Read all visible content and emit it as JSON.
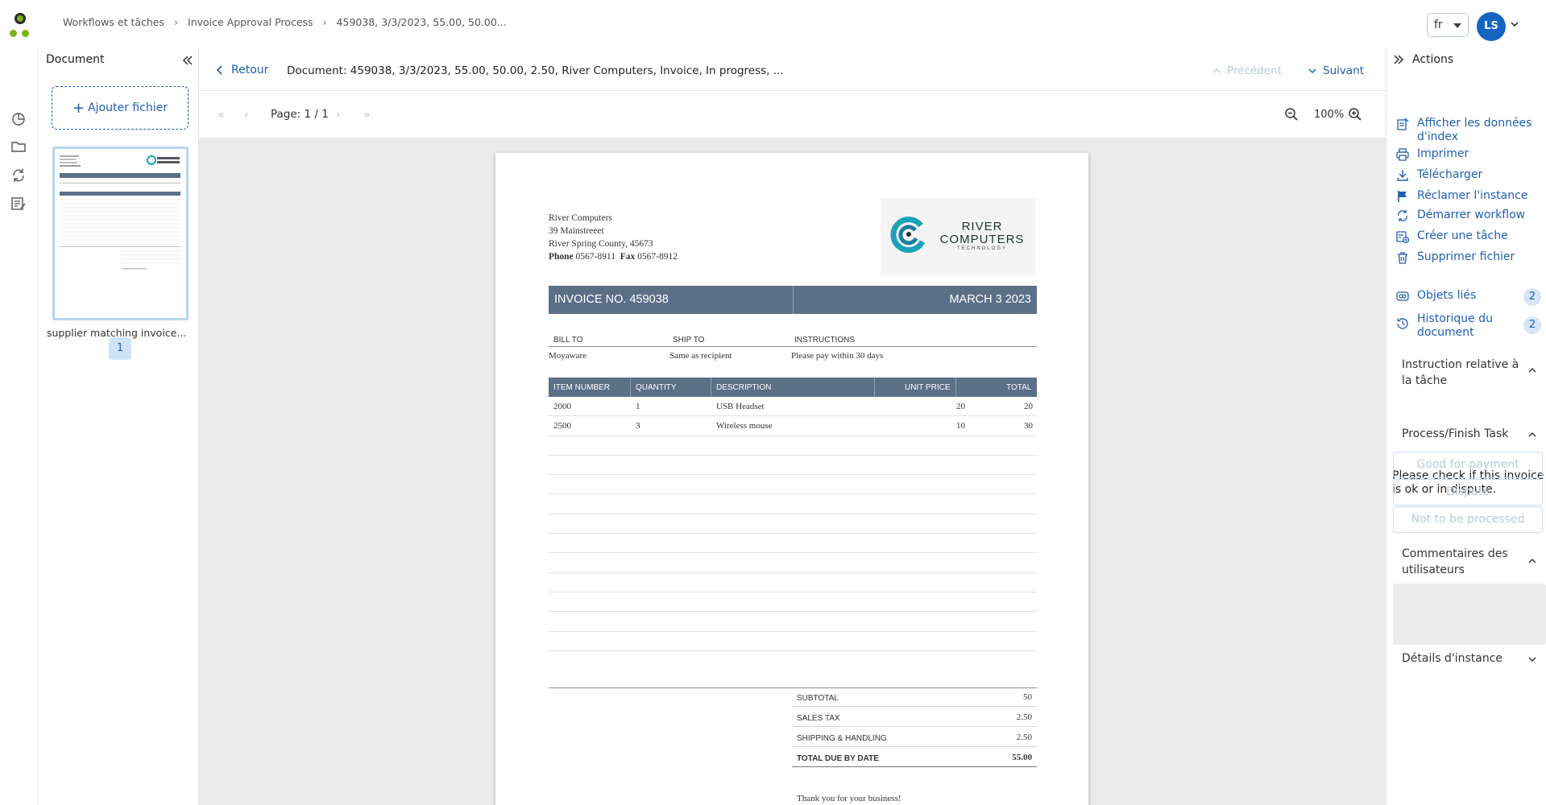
{
  "colors": {
    "accent": "#1f5fb0",
    "avatar": "#1565c0",
    "invoice_band": "#5b6f87",
    "logo_teal": "#1aa3b8"
  },
  "breadcrumb": {
    "items": [
      "Workflows et tâches",
      "Invoice Approval Process",
      "459038, 3/3/2023, 55.00, 50.00..."
    ]
  },
  "header": {
    "language": "fr",
    "user_initials": "LS"
  },
  "rail": {
    "icons": [
      "dashboard-icon",
      "folder-icon",
      "sync-icon",
      "task-list-icon"
    ]
  },
  "document_panel": {
    "title": "Document",
    "add_file_label": "Ajouter fichier",
    "file_name": "supplier matching invoice...",
    "page_count": "1"
  },
  "viewer": {
    "back_label": "Retour",
    "document_title": "Document: 459038, 3/3/2023, 55.00, 50.00, 2.50, River Computers, Invoice, In progress, ...",
    "prev_label": "Précédent",
    "next_label": "Suivant",
    "page_info": "Page: 1 / 1",
    "zoom": "100%"
  },
  "invoice": {
    "from": {
      "name": "River Computers",
      "street": "39 Mainstreeet",
      "city": "River Spring County,  45673",
      "phone_label": "Phone",
      "phone": "0567-8911",
      "fax_label": "Fax",
      "fax": "0567-8912"
    },
    "logo": {
      "line1": "RIVER",
      "line2": "COMPUTERS",
      "line3": "TECHNOLOGY"
    },
    "number": "INVOICE NO. 459038",
    "date": "MARCH 3 2023",
    "bill_headers": [
      "BILL TO",
      "SHIP TO",
      "INSTRUCTIONS"
    ],
    "bill_values": [
      "Moyaware",
      "Same as recipient",
      "Please pay within 30 days"
    ],
    "table_headers": [
      "ITEM NUMBER",
      "QUANTITY",
      "DESCRIPTION",
      "UNIT PRICE",
      "TOTAL"
    ],
    "rows": [
      [
        "2000",
        "1",
        "USB Headset",
        "20",
        "20"
      ],
      [
        "2500",
        "3",
        "Wireless mouse",
        "10",
        "30"
      ],
      [
        "",
        "",
        "",
        "",
        ""
      ],
      [
        "",
        "",
        "",
        "",
        ""
      ],
      [
        "",
        "",
        "",
        "",
        ""
      ],
      [
        "",
        "",
        "",
        "",
        ""
      ],
      [
        "",
        "",
        "",
        "",
        ""
      ],
      [
        "",
        "",
        "",
        "",
        ""
      ],
      [
        "",
        "",
        "",
        "",
        ""
      ],
      [
        "",
        "",
        "",
        "",
        ""
      ],
      [
        "",
        "",
        "",
        "",
        ""
      ],
      [
        "",
        "",
        "",
        "",
        ""
      ],
      [
        "",
        "",
        "",
        "",
        ""
      ]
    ],
    "totals": [
      {
        "label": "SUBTOTAL",
        "value": "50"
      },
      {
        "label": "SALES TAX",
        "value": "2.50"
      },
      {
        "label": "SHIPPING & HANDLING",
        "value": "2.50"
      },
      {
        "label": "TOTAL DUE BY DATE",
        "value": "55.00"
      }
    ],
    "thanks": "Thank you for your business!"
  },
  "actions": {
    "title": "Actions",
    "items": [
      {
        "label": "Afficher les données d'index",
        "icon": "index-data-icon"
      },
      {
        "label": "Imprimer",
        "icon": "printer-icon"
      },
      {
        "label": "Télécharger",
        "icon": "download-icon"
      },
      {
        "label": "Réclamer l'instance",
        "icon": "flag-icon"
      },
      {
        "label": "Démarrer workflow",
        "icon": "workflow-icon"
      },
      {
        "label": "Créer une tâche",
        "icon": "create-task-icon"
      },
      {
        "label": "Supprimer fichier",
        "icon": "trash-icon"
      }
    ],
    "linked_objects": {
      "label": "Objets liés",
      "count": "2"
    },
    "history": {
      "label": "Historique du document",
      "count": "2"
    },
    "instruction_section": "Instruction relative à la tâche",
    "instruction_text": "Please check if this invoice is ok or in dispute.",
    "process_section": "Process/Finish Task",
    "task_buttons": [
      "Good for payment",
      "Dispute",
      "Not to be processed"
    ],
    "comments_section": "Commentaires des utilisateurs",
    "details_section": "Détails d'instance"
  }
}
